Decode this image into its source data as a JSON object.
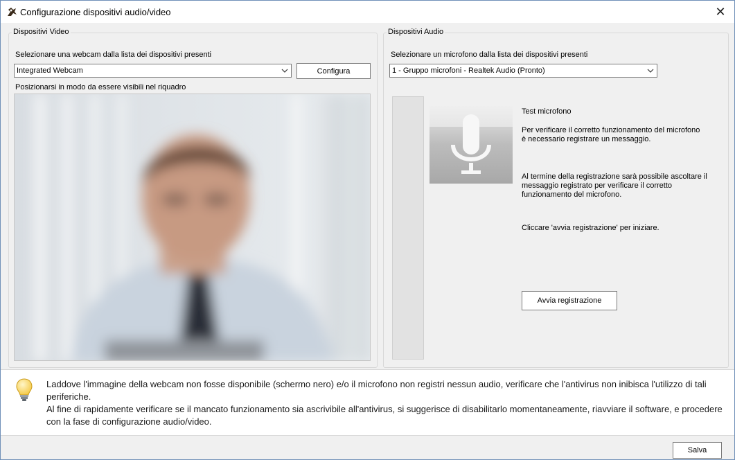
{
  "window": {
    "title": "Configurazione dispositivi audio/video",
    "icon": "app-icon",
    "close_glyph": "✕"
  },
  "video": {
    "group_label": "Dispositivi Video",
    "select_label": "Selezionare una webcam dalla lista dei dispositivi presenti",
    "selected_device": "Integrated Webcam",
    "configure_button": "Configura",
    "position_hint": "Posizionarsi in modo da essere visibili nel riquadro"
  },
  "audio": {
    "group_label": "Dispositivi Audio",
    "select_label": "Selezionare un microfono dalla lista dei dispositivi presenti",
    "selected_device": "1 - Gruppo microfoni - Realtek Audio (Pronto)",
    "test_title": "Test microfono",
    "paragraph1": "Per verificare il corretto funzionamento del microfono è necessario registrare un messaggio.",
    "paragraph2": "Al termine della registrazione sarà possibile ascoltare il messaggio registrato per verificare il corretto funzionamento del microfono.",
    "paragraph3": "Cliccare 'avvia registrazione' per iniziare.",
    "record_button": "Avvia registrazione",
    "level": 0
  },
  "tip": {
    "icon": "lightbulb-icon",
    "line1": "Laddove l'immagine della webcam non fosse disponibile (schermo nero) e/o il microfono non registri nessun audio, verificare che l'antivirus non inibisca l'utilizzo di tali periferiche.",
    "line2": "Al fine di rapidamente verificare se il mancato funzionamento sia ascrivibile all'antivirus, si suggerisce di disabilitarlo momentaneamente, riavviare il software, e procedere con la fase di configurazione audio/video."
  },
  "footer": {
    "save_button": "Salva"
  },
  "colors": {
    "window_border": "#6f8fb8",
    "dialog_bg": "#f0f0f0",
    "bulb": "#f5c842"
  }
}
